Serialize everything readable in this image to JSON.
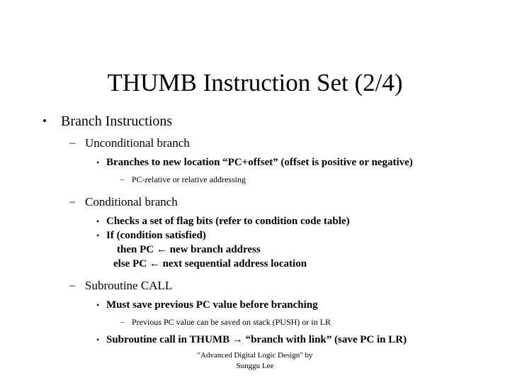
{
  "slide": {
    "title": "THUMB Instruction Set (2/4)",
    "background_color": "#ffffff",
    "text_color": "#000000",
    "bullet_glyphs": {
      "level1": "•",
      "level2": "–",
      "level3": "•",
      "level4": "–"
    },
    "outline": {
      "l1_branch_instructions": "Branch Instructions",
      "l2_unconditional_branch": "Unconditional branch",
      "l3_branches_to_new_location": "Branches to new location “PC+offset” (offset is positive or negative)",
      "l4_pc_relative": "PC-relative or relative addressing",
      "l2_conditional_branch": "Conditional branch",
      "l3_checks_flag_bits": "Checks a set of flag bits (refer to condition code table)",
      "l3_if_condition_satisfied": "If (condition satisfied)",
      "cont_then_pc": "then PC ← new branch address",
      "cont_else_pc": "else PC ← next sequential address location",
      "l2_subroutine_call": "Subroutine CALL",
      "l3_must_save_pc": "Must save previous PC value before branching",
      "l4_previous_pc_stack": "Previous PC value can be saved on stack (PUSH) or in LR",
      "l3_subroutine_call_thumb": "Subroutine call in THUMB → “branch with link” (save PC in LR)"
    },
    "footer": {
      "line1": "\"Advanced Digital Logic Design\" by",
      "line2": "Sunggu Lee"
    }
  }
}
